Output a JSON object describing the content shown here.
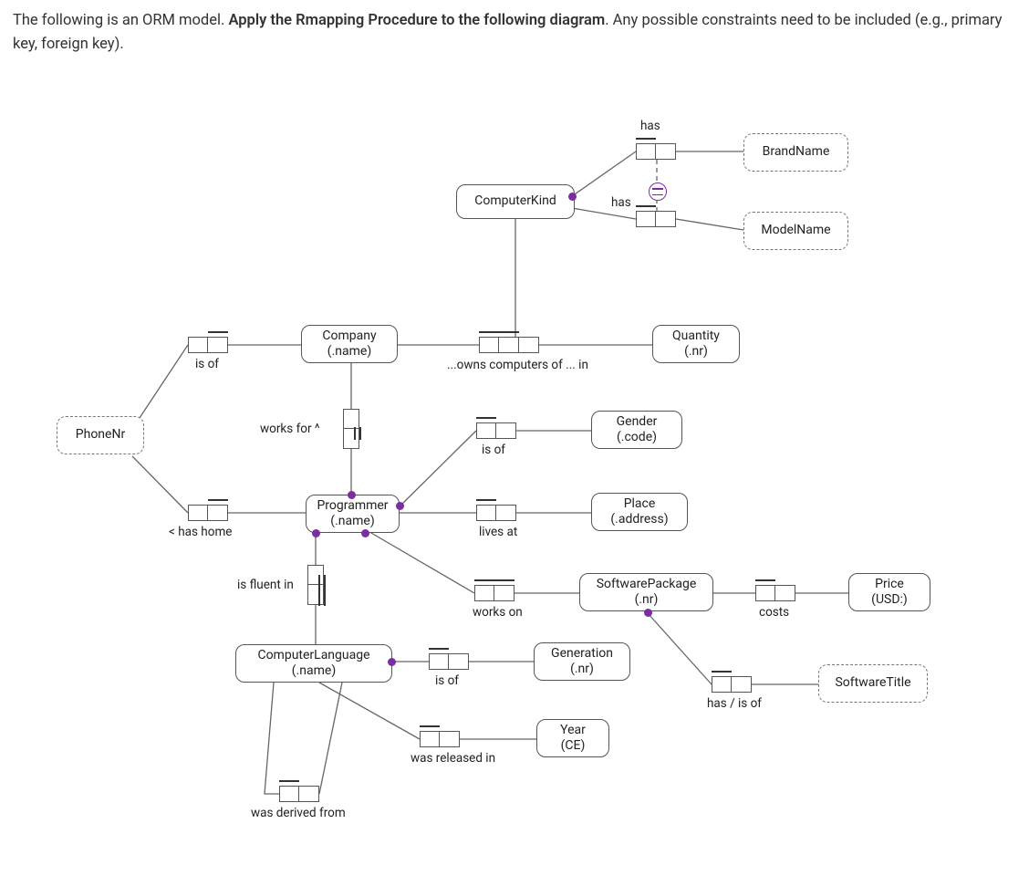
{
  "prompt": {
    "pre": "The following is an ORM model. ",
    "bold": "Apply the Rmapping Procedure to the following diagram",
    "post": ". Any possible constraints need to be included (e.g., primary key, foreign key)."
  },
  "entities": {
    "computerKind": "ComputerKind",
    "brandName": "BrandName",
    "modelName": "ModelName",
    "company_l1": "Company",
    "company_l2": "(.name)",
    "quantity_l1": "Quantity",
    "quantity_l2": "(.nr)",
    "phoneNr": "PhoneNr",
    "gender_l1": "Gender",
    "gender_l2": "(.code)",
    "programmer_l1": "Programmer",
    "programmer_l2": "(.name)",
    "place_l1": "Place",
    "place_l2": "(.address)",
    "software_l1": "SoftwarePackage",
    "software_l2": "(.nr)",
    "price_l1": "Price",
    "price_l2": "(USD:)",
    "complang_l1": "ComputerLanguage",
    "complang_l2": "(.name)",
    "generation_l1": "Generation",
    "generation_l2": "(.nr)",
    "year_l1": "Year",
    "year_l2": "(CE)",
    "softwareTitle": "SoftwareTitle"
  },
  "roles": {
    "has_brand": "has",
    "has_model": "has",
    "is_of_phone": "is of",
    "owns_computers": "...owns computers of ... in",
    "works_for": "works for ^",
    "is_of_gender": "is of",
    "has_home": "< has home",
    "lives_at": "lives at",
    "is_fluent": "is fluent in",
    "works_on": "works on",
    "is_of_generation": "is of",
    "was_released": "was released in",
    "was_derived": "was derived from",
    "costs": "costs",
    "has_is_of": "has / is of"
  },
  "chart_data": {
    "type": "orm-diagram",
    "object_types": [
      {
        "name": "ComputerKind",
        "kind": "entity"
      },
      {
        "name": "BrandName",
        "kind": "value"
      },
      {
        "name": "ModelName",
        "kind": "value"
      },
      {
        "name": "Company",
        "ref": ".name",
        "kind": "entity"
      },
      {
        "name": "Quantity",
        "ref": ".nr",
        "kind": "entity"
      },
      {
        "name": "PhoneNr",
        "kind": "value"
      },
      {
        "name": "Gender",
        "ref": ".code",
        "kind": "entity"
      },
      {
        "name": "Programmer",
        "ref": ".name",
        "kind": "entity"
      },
      {
        "name": "Place",
        "ref": ".address",
        "kind": "entity"
      },
      {
        "name": "SoftwarePackage",
        "ref": ".nr",
        "kind": "entity"
      },
      {
        "name": "Price",
        "ref": "USD:",
        "kind": "entity"
      },
      {
        "name": "ComputerLanguage",
        "ref": ".name",
        "kind": "entity"
      },
      {
        "name": "Generation",
        "ref": ".nr",
        "kind": "entity"
      },
      {
        "name": "Year",
        "ref": "CE",
        "kind": "entity"
      },
      {
        "name": "SoftwareTitle",
        "kind": "value"
      }
    ],
    "fact_types": [
      {
        "reading": "ComputerKind has BrandName",
        "arity": 2,
        "mandatory_on": [
          "ComputerKind"
        ],
        "uniqueness": "first",
        "external_uniqueness_group": "ck-compound"
      },
      {
        "reading": "ComputerKind has ModelName",
        "arity": 2,
        "mandatory_on": [
          "ComputerKind"
        ],
        "uniqueness": "first",
        "external_uniqueness_group": "ck-compound"
      },
      {
        "reading": "Company is of PhoneNr",
        "arity": 2,
        "uniqueness": "second"
      },
      {
        "reading": "Company owns computers of ComputerKind in Quantity",
        "arity": 3,
        "uniqueness": "first_two"
      },
      {
        "reading": "Programmer works for Company",
        "arity": 2,
        "mandatory_on": [
          "Programmer"
        ],
        "uniqueness": "first"
      },
      {
        "reading": "Programmer is of Gender",
        "arity": 2,
        "mandatory_on": [
          "Programmer"
        ],
        "uniqueness": "first"
      },
      {
        "reading": "Programmer has home PhoneNr",
        "arity": 2,
        "uniqueness": "second"
      },
      {
        "reading": "Programmer lives at Place",
        "arity": 2,
        "mandatory_on": [
          "Programmer"
        ],
        "uniqueness": "first"
      },
      {
        "reading": "Programmer is fluent in ComputerLanguage",
        "arity": 2,
        "mandatory_on": [
          "Programmer"
        ],
        "uniqueness": "spanning"
      },
      {
        "reading": "Programmer works on SoftwarePackage",
        "arity": 2,
        "mandatory_on": [
          "Programmer"
        ],
        "uniqueness": "spanning"
      },
      {
        "reading": "ComputerLanguage is of Generation",
        "arity": 2,
        "mandatory_on": [
          "ComputerLanguage"
        ],
        "uniqueness": "first"
      },
      {
        "reading": "ComputerLanguage was released in Year",
        "arity": 2,
        "uniqueness": "first"
      },
      {
        "reading": "ComputerLanguage was derived from ComputerLanguage",
        "arity": 2,
        "uniqueness": "first"
      },
      {
        "reading": "SoftwarePackage costs Price",
        "arity": 2,
        "uniqueness": "first"
      },
      {
        "reading": "SoftwarePackage has / is of SoftwareTitle",
        "arity": 2,
        "mandatory_on": [
          "SoftwarePackage"
        ],
        "uniqueness": "first"
      }
    ]
  }
}
